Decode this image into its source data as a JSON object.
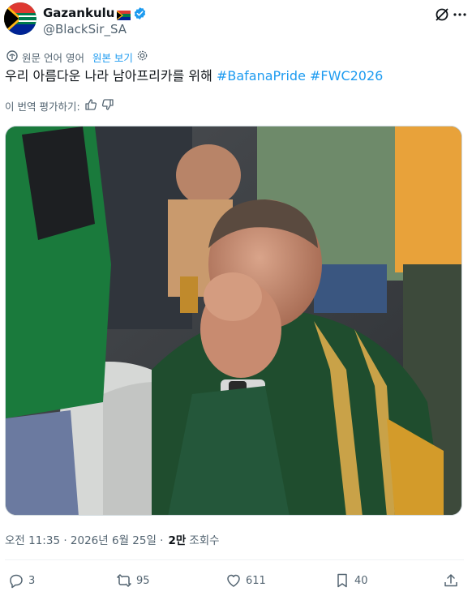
{
  "author": {
    "display_name": "Gazankulu",
    "handle": "@BlackSir_SA"
  },
  "translation_bar": {
    "note": "원문 언어 영어",
    "show_original": "원본 보기"
  },
  "tweet": {
    "text": "우리 아름다운 나라 남아프리카를 위해 ",
    "hashtags": [
      "#BafanaPride",
      "#FWC2026"
    ]
  },
  "rate_translation": {
    "label": "이 번역 평가하기:"
  },
  "meta": {
    "time": "오전 11:35 · 2026년 6월 25일 · ",
    "views_count": "2만",
    "views_label": "조회수"
  },
  "actions": {
    "replies": "3",
    "reposts": "95",
    "likes": "611",
    "bookmarks": "40"
  },
  "colors": {
    "accent": "#1d9bf0",
    "text_secondary": "#536471",
    "text_primary": "#0f1419"
  }
}
